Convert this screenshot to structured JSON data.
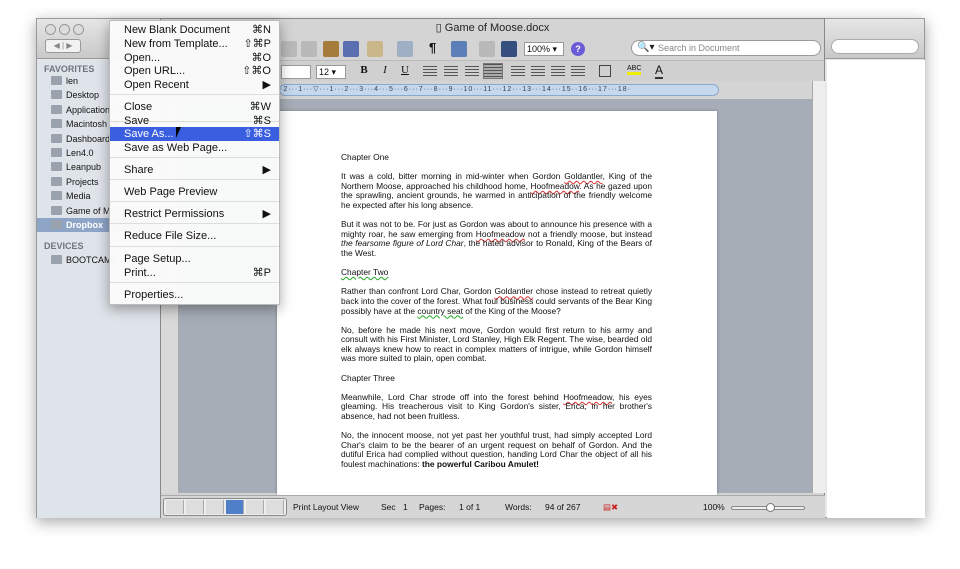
{
  "finder": {
    "favorites_header": "FAVORITES",
    "devices_header": "DEVICES",
    "favorites": [
      "len",
      "Desktop",
      "Applications",
      "Macintosh HD",
      "Dashboard",
      "Len4.0",
      "Leanpub",
      "Projects",
      "Media",
      "Game of Moose",
      "Dropbox"
    ],
    "devices": [
      "BOOTCAMP"
    ],
    "selected": "Dropbox"
  },
  "window": {
    "title": "Game of Moose.docx"
  },
  "toolbar": {
    "zoom": "100%",
    "search_placeholder": "Search in Document",
    "help": "?"
  },
  "format": {
    "font_size": "12",
    "bold": "B",
    "italic": "I",
    "underline": "U",
    "font_color": "A",
    "highlight": "ABC"
  },
  "ruler": {
    "ticks": "·2···1···▽···1···2···3···4···5···6···7···8···9···10···11···12···13···14···15··16···17···18·"
  },
  "menu": {
    "items": [
      {
        "label": "New Blank Document",
        "shortcut": "⌘N"
      },
      {
        "label": "New from Template...",
        "shortcut": "⇧⌘P"
      },
      {
        "label": "Open...",
        "shortcut": "⌘O"
      },
      {
        "label": "Open URL...",
        "shortcut": "⇧⌘O"
      },
      {
        "label": "Open Recent",
        "shortcut": "▶"
      },
      {
        "label": "Close",
        "shortcut": "⌘W"
      },
      {
        "label": "Save",
        "shortcut": "⌘S"
      },
      {
        "label": "Save As...",
        "shortcut": "⇧⌘S"
      },
      {
        "label": "Save as Web Page...",
        "shortcut": ""
      },
      {
        "label": "Share",
        "shortcut": "▶"
      },
      {
        "label": "Web Page Preview",
        "shortcut": ""
      },
      {
        "label": "Restrict Permissions",
        "shortcut": "▶"
      },
      {
        "label": "Reduce File Size...",
        "shortcut": ""
      },
      {
        "label": "Page Setup...",
        "shortcut": ""
      },
      {
        "label": "Print...",
        "shortcut": "⌘P"
      },
      {
        "label": "Properties...",
        "shortcut": ""
      }
    ],
    "highlighted": "Save As..."
  },
  "document": {
    "h1": "Chapter One",
    "p1": [
      "It was a cold, bitter morning in mid-winter when Gordon ",
      "Goldantler",
      ", King of the Northern Moose, approached his childhood home, ",
      "Hoofmeadow",
      ". As he gazed upon the sprawling, ancient grounds, he warmed in anticipation of the friendly welcome he expected after his long absence."
    ],
    "p2": [
      "But it was not to be. For just as Gordon was about to announce his presence with a mighty roar, he saw emerging from ",
      "Hoofmeadow",
      " not a friendly moose, but instead ",
      "the fearsome figure of Lord Char",
      ", the hated advisor to Ronald, King of the Bears of the West."
    ],
    "h2": "Chapter  Two",
    "p3": [
      "Rather than confront Lord Char, Gordon ",
      "Goldantler",
      " chose instead to retreat quietly back into the cover of the forest. What foul business could servants of the Bear King possibly have at the ",
      "country seat",
      " of the King of the Moose?"
    ],
    "p4": "No, before he made his next move, Gordon would first return to his army and consult with his First Minister, Lord Stanley, High Elk Regent. The wise, bearded old elk always knew how to react in complex matters of intrigue, while Gordon himself was more suited to plain, open combat.",
    "h3": "Chapter Three",
    "p5": [
      "Meanwhile, Lord Char strode off into the forest behind ",
      "Hoofmeadow",
      ", his eyes gleaming. His treacherous visit to King Gordon's sister, Erica, in her brother's absence, had not been fruitless."
    ],
    "p6": [
      "No, the innocent moose, not yet past her youthful trust, had simply accepted Lord Char's claim to be the bearer of an urgent request on behalf of Gordon. And the dutiful Erica had complied without question, handing Lord Char the object of all his foulest machinations: ",
      "the powerful Caribou Amulet!"
    ]
  },
  "status": {
    "view": "Print Layout View",
    "sec_label": "Sec",
    "sec": "1",
    "pages_label": "Pages:",
    "pages": "1 of 1",
    "words_label": "Words:",
    "words": "94 of 267",
    "zoom": "100%",
    "zoom_level_percent": 100,
    "active_view": "print-layout"
  }
}
